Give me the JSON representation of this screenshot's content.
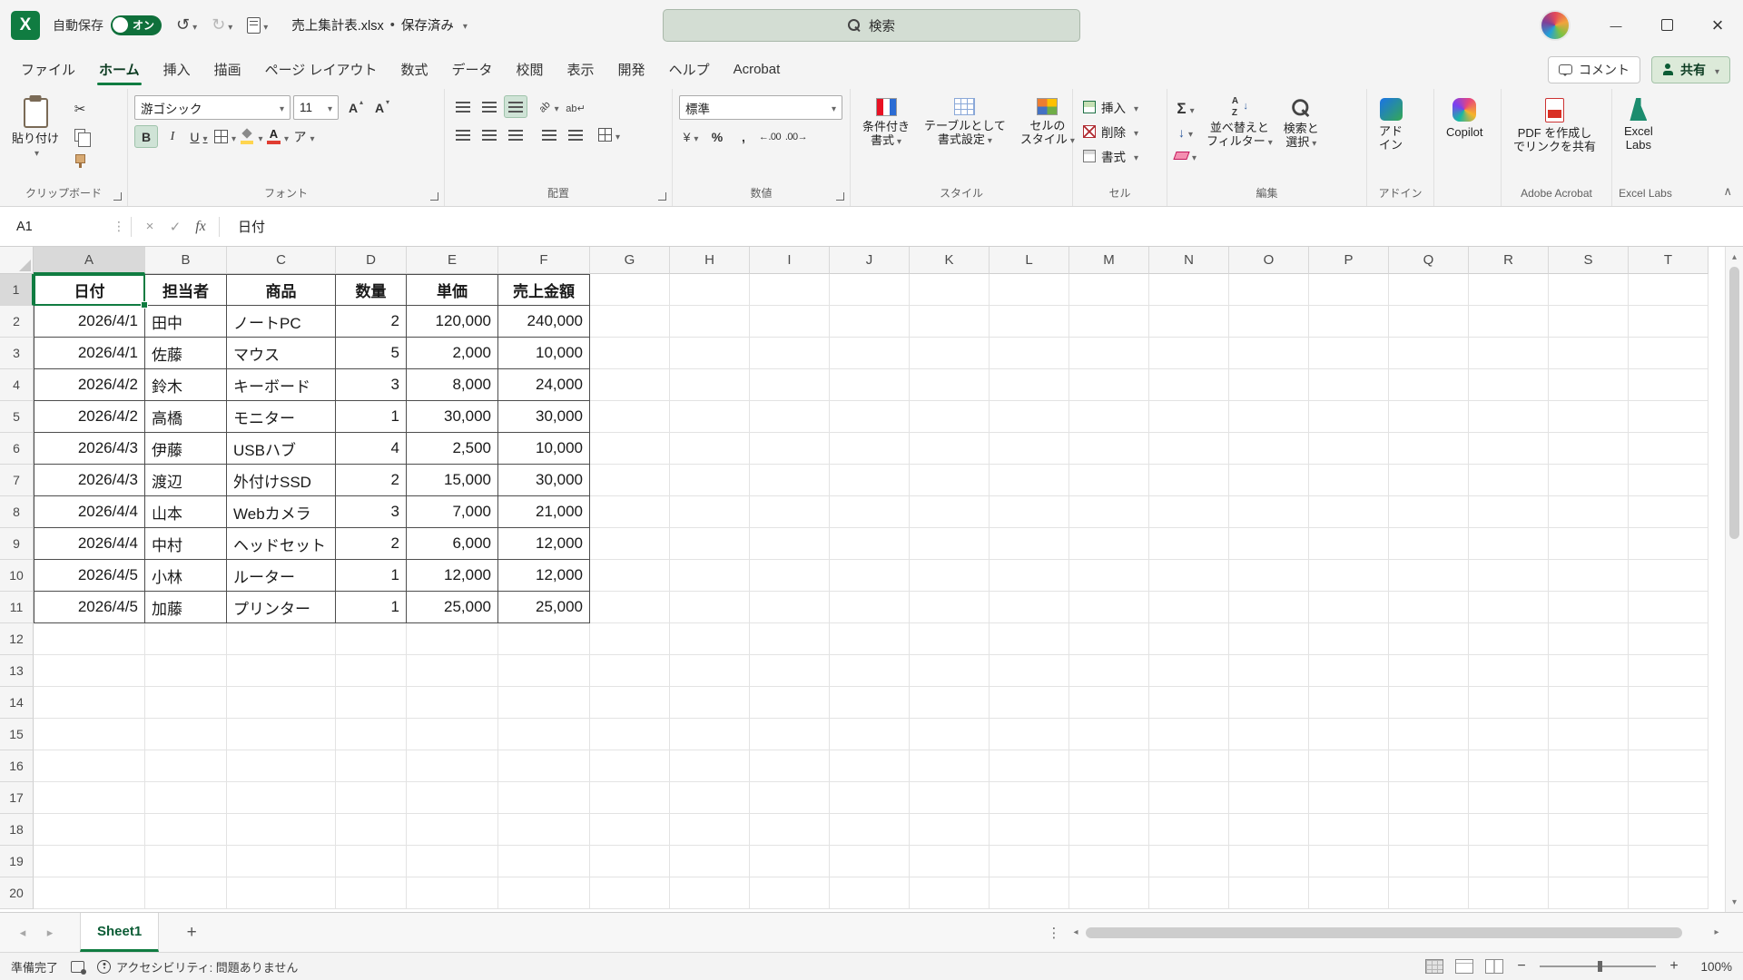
{
  "window": {
    "autosave_label": "自動保存",
    "autosave_state": "オン",
    "title": "売上集計表.xlsx",
    "saved_status": "保存済み",
    "search_placeholder": "検索"
  },
  "menubar": {
    "tabs": [
      {
        "id": "file",
        "label": "ファイル"
      },
      {
        "id": "home",
        "label": "ホーム",
        "active": true
      },
      {
        "id": "insert",
        "label": "挿入"
      },
      {
        "id": "draw",
        "label": "描画"
      },
      {
        "id": "page-layout",
        "label": "ページ レイアウト"
      },
      {
        "id": "formulas",
        "label": "数式"
      },
      {
        "id": "data",
        "label": "データ"
      },
      {
        "id": "review",
        "label": "校閲"
      },
      {
        "id": "view",
        "label": "表示"
      },
      {
        "id": "developer",
        "label": "開発"
      },
      {
        "id": "help",
        "label": "ヘルプ"
      },
      {
        "id": "acrobat",
        "label": "Acrobat"
      }
    ],
    "comment_label": "コメント",
    "share_label": "共有"
  },
  "ribbon": {
    "clipboard": {
      "group": "クリップボード",
      "paste": "貼り付け"
    },
    "font": {
      "group": "フォント",
      "name": "游ゴシック",
      "size": "11",
      "bold": "B",
      "italic": "I",
      "underline": "U",
      "grow": "A",
      "shrink": "A",
      "color_letter": "A",
      "ruby": "ア"
    },
    "alignment": {
      "group": "配置"
    },
    "number": {
      "group": "数値",
      "format": "標準",
      "percent": "%",
      "comma": ",",
      "inc": "←.00",
      "dec": ".00→"
    },
    "styles": {
      "group": "スタイル",
      "buttons": [
        [
          "条件付き",
          "書式"
        ],
        [
          "テーブルとして",
          "書式設定"
        ],
        [
          "セルの",
          "スタイル"
        ]
      ]
    },
    "cells": {
      "group": "セル",
      "buttons": [
        "挿入",
        "削除",
        "書式"
      ]
    },
    "editing": {
      "group": "編集",
      "sigma": "Σ",
      "buttons": [
        [
          "並べ替えと",
          "フィルター"
        ],
        [
          "検索と",
          "選択"
        ]
      ]
    },
    "addins": {
      "group": "アドイン",
      "addin": [
        "アド",
        "イン"
      ],
      "copilot": "Copilot"
    },
    "acrobat": {
      "group": "Adobe Acrobat",
      "pdf": [
        "PDF を作成し",
        "でリンクを共有"
      ]
    },
    "labs": {
      "group": "Excel Labs",
      "name": [
        "Excel",
        "Labs"
      ]
    }
  },
  "formula_bar": {
    "cell_ref": "A1",
    "fx": "fx",
    "value": "日付"
  },
  "grid": {
    "column_letters": [
      "A",
      "B",
      "C",
      "D",
      "E",
      "F",
      "G",
      "H",
      "I",
      "J",
      "K",
      "L",
      "M",
      "N",
      "O",
      "P",
      "Q",
      "R",
      "S",
      "T"
    ],
    "visible_rows": 20,
    "selected_cell": "A1"
  },
  "table": {
    "headers": [
      "日付",
      "担当者",
      "商品",
      "数量",
      "単価",
      "売上金額"
    ],
    "rows": [
      [
        "2026/4/1",
        "田中",
        "ノートPC",
        "2",
        "120,000",
        "240,000"
      ],
      [
        "2026/4/1",
        "佐藤",
        "マウス",
        "5",
        "2,000",
        "10,000"
      ],
      [
        "2026/4/2",
        "鈴木",
        "キーボード",
        "3",
        "8,000",
        "24,000"
      ],
      [
        "2026/4/2",
        "高橋",
        "モニター",
        "1",
        "30,000",
        "30,000"
      ],
      [
        "2026/4/3",
        "伊藤",
        "USBハブ",
        "4",
        "2,500",
        "10,000"
      ],
      [
        "2026/4/3",
        "渡辺",
        "外付けSSD",
        "2",
        "15,000",
        "30,000"
      ],
      [
        "2026/4/4",
        "山本",
        "Webカメラ",
        "3",
        "7,000",
        "21,000"
      ],
      [
        "2026/4/4",
        "中村",
        "ヘッドセット",
        "2",
        "6,000",
        "12,000"
      ],
      [
        "2026/4/5",
        "小林",
        "ルーター",
        "1",
        "12,000",
        "12,000"
      ],
      [
        "2026/4/5",
        "加藤",
        "プリンター",
        "1",
        "25,000",
        "25,000"
      ]
    ]
  },
  "sheet_tabs": {
    "sheets": [
      "Sheet1"
    ],
    "active": "Sheet1"
  },
  "statusbar": {
    "ready": "準備完了",
    "accessibility": "アクセシビリティ: 問題ありません",
    "zoom": "100%"
  },
  "colors": {
    "accent": "#107C41",
    "accent_dark": "#0C5C35"
  }
}
